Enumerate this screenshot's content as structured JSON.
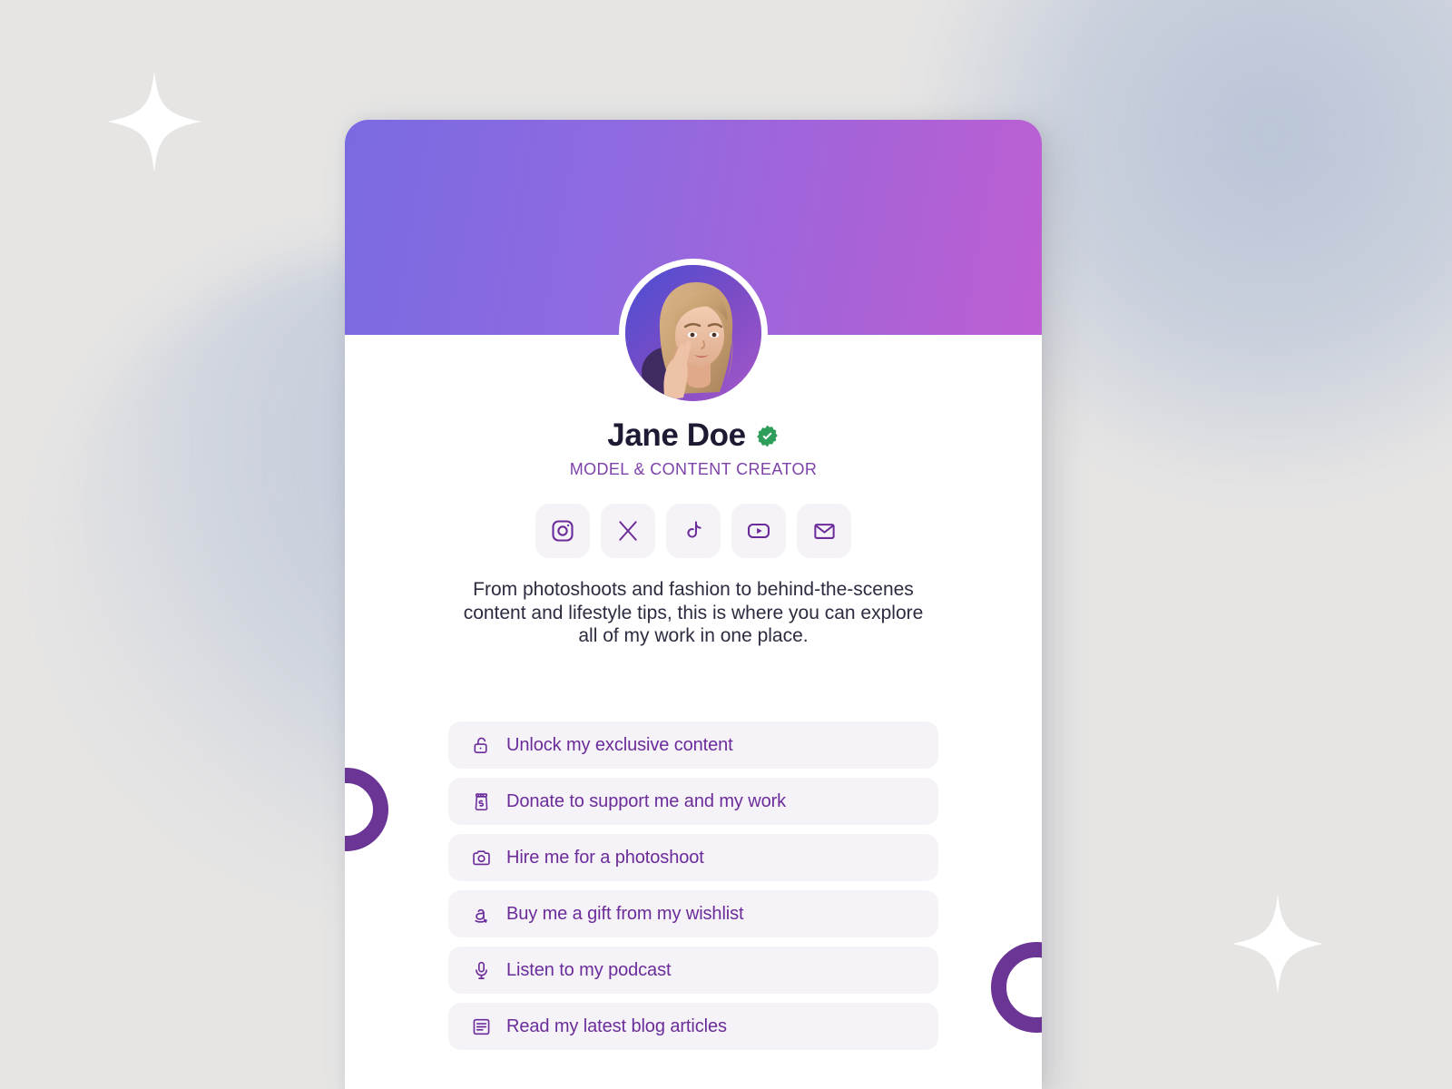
{
  "profile": {
    "display_name": "Jane Doe",
    "verified": true,
    "tagline": "MODEL & CONTENT CREATOR",
    "bio": "From photoshoots and fashion to behind-the-scenes content and lifestyle tips, this is where you can explore all of my work in one place.",
    "avatar_alt": "Portrait photo of a blonde woman making a peace sign beside her eye"
  },
  "colors": {
    "banner_gradient_start": "#7a6ae2",
    "banner_gradient_end": "#bd5fd2",
    "accent_purple": "#6b2c9a",
    "tagline_purple": "#7e43a8",
    "verified_green": "#2f9e5a",
    "link_background": "#f5f2f8",
    "social_background": "#f5f3f8",
    "page_background": "#e6e5e4",
    "ring_purple": "#6b3596",
    "card_background": "#ffffff"
  },
  "socials": [
    {
      "name": "instagram",
      "icon": "instagram-icon",
      "label": "Instagram"
    },
    {
      "name": "x",
      "icon": "x-twitter-icon",
      "label": "X"
    },
    {
      "name": "tiktok",
      "icon": "tiktok-icon",
      "label": "TikTok"
    },
    {
      "name": "youtube",
      "icon": "youtube-icon",
      "label": "YouTube"
    },
    {
      "name": "email",
      "icon": "envelope-icon",
      "label": "Email"
    }
  ],
  "links": [
    {
      "label": "Unlock my exclusive content",
      "icon": "unlock-icon"
    },
    {
      "label": "Donate to support me and my work",
      "icon": "tip-jar-icon"
    },
    {
      "label": "Hire me for a photoshoot",
      "icon": "camera-icon"
    },
    {
      "label": "Buy me a gift from my wishlist",
      "icon": "amazon-icon"
    },
    {
      "label": "Listen to my podcast",
      "icon": "microphone-icon"
    },
    {
      "label": "Read my latest blog articles",
      "icon": "article-icon"
    }
  ],
  "decorations": {
    "sparkles": 2,
    "rings": 2
  }
}
